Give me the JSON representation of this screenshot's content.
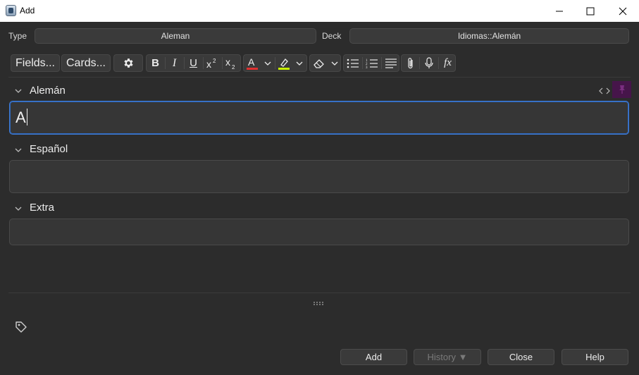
{
  "window": {
    "title": "Add"
  },
  "top": {
    "type_label": "Type",
    "type_value": "Aleman",
    "deck_label": "Deck",
    "deck_value": "Idiomas::Alemán"
  },
  "toolbar": {
    "fields_label": "Fields...",
    "cards_label": "Cards...",
    "bold": "B",
    "italic": "I",
    "underline": "U",
    "text_color": "A",
    "text_color_bar": "#e03030",
    "highlight_color_bar": "#c8f000",
    "function": "fx"
  },
  "fields": [
    {
      "label": "Alemán",
      "value": "A"
    },
    {
      "label": "Español",
      "value": ""
    },
    {
      "label": "Extra",
      "value": ""
    }
  ],
  "buttons": {
    "add": "Add",
    "history": "History ▼",
    "close": "Close",
    "help": "Help"
  },
  "colors": {
    "accent": "#3e7bd6",
    "sticky_pin": "#46154a"
  }
}
